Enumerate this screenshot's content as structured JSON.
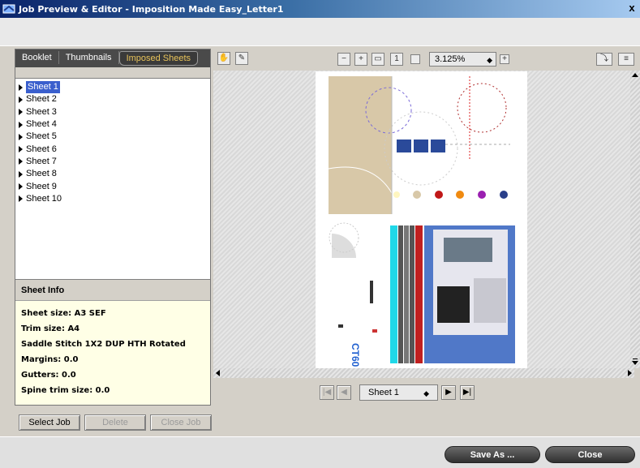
{
  "window": {
    "title": "Job Preview & Editor - Imposition Made Easy_Letter1",
    "close_glyph": "x"
  },
  "tabs": [
    {
      "label": "Booklet",
      "active": false
    },
    {
      "label": "Thumbnails",
      "active": false
    },
    {
      "label": "Imposed Sheets",
      "active": true
    }
  ],
  "sheets": [
    "Sheet 1",
    "Sheet 2",
    "Sheet 3",
    "Sheet 4",
    "Sheet 5",
    "Sheet 6",
    "Sheet 7",
    "Sheet 8",
    "Sheet 9",
    "Sheet 10"
  ],
  "selected_sheet": "Sheet 1",
  "sheet_info": {
    "header": "Sheet Info",
    "lines": [
      "Sheet size: A3 SEF",
      "Trim size: A4",
      "Saddle Stitch 1X2 DUP HTH Rotated",
      "Margins: 0.0",
      "Gutters: 0.0",
      "Spine trim size: 0.0"
    ]
  },
  "left_buttons": {
    "select_job": "Select Job",
    "delete": "Delete",
    "close_job": "Close Job"
  },
  "toolbar": {
    "zoom_value": "3.125%"
  },
  "navigation": {
    "current_sheet": "Sheet 1"
  },
  "footer": {
    "save_as": "Save As ...",
    "close": "Close"
  },
  "preview": {
    "logo_text": "CT60"
  },
  "colors": {
    "accent_tab": "#e8c35a",
    "selection": "#3a5fcd",
    "info_bg": "#ffffe6",
    "swatches": [
      "#d8c8a8",
      "#c01818",
      "#f08a10",
      "#9a20b0",
      "#2a3f8a"
    ]
  }
}
